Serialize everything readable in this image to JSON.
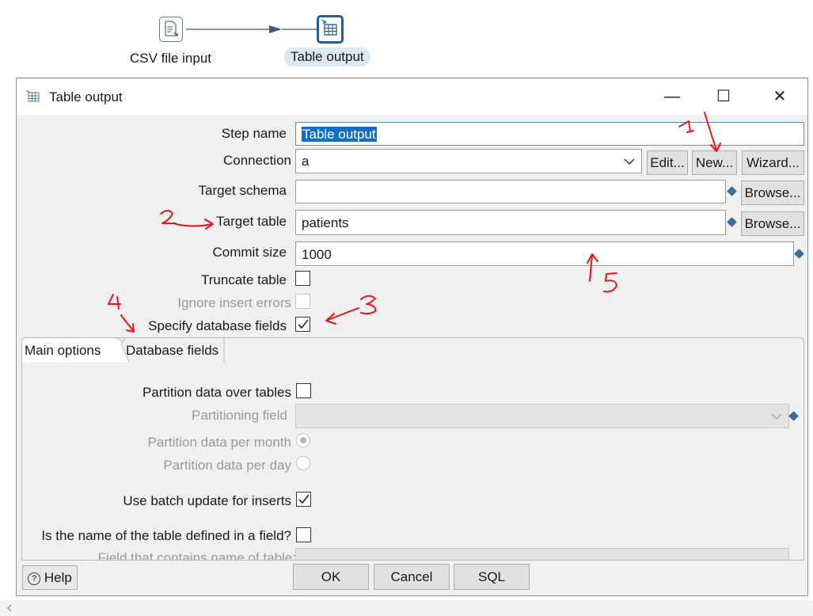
{
  "canvas": {
    "steps": [
      {
        "label": "CSV file input",
        "icon": "csv-file-icon"
      },
      {
        "label": "Table output",
        "icon": "table-output-icon"
      }
    ]
  },
  "dialog": {
    "title": "Table output",
    "controls": {
      "minimize": "—",
      "maximize": "☐",
      "close": "✕"
    },
    "step_name": {
      "label": "Step name",
      "value": "Table output"
    },
    "connection": {
      "label": "Connection",
      "value": "a",
      "edit": "Edit...",
      "new": "New...",
      "wizard": "Wizard..."
    },
    "target_schema": {
      "label": "Target schema",
      "value": "",
      "browse": "Browse..."
    },
    "target_table": {
      "label": "Target table",
      "value": "patients",
      "browse": "Browse..."
    },
    "commit_size": {
      "label": "Commit size",
      "value": "1000"
    },
    "truncate_table": {
      "label": "Truncate table",
      "checked": false
    },
    "ignore_insert_errors": {
      "label": "Ignore insert errors",
      "checked": false,
      "disabled": true
    },
    "specify_db_fields": {
      "label": "Specify database fields",
      "checked": true
    },
    "tabs": [
      "Main options",
      "Database fields"
    ],
    "main_options": {
      "partition_over_tables": {
        "label": "Partition data over tables",
        "checked": false
      },
      "partitioning_field": {
        "label": "Partitioning field",
        "value": ""
      },
      "partition_per_month": {
        "label": "Partition data per month"
      },
      "partition_per_day": {
        "label": "Partition data per day"
      },
      "batch_update": {
        "label": "Use batch update for inserts",
        "checked": true
      },
      "table_name_in_field": {
        "label": "Is the name of the table defined in a field?",
        "checked": false
      },
      "field_containing_table": {
        "label": "Field that contains name of table:"
      }
    },
    "buttons": {
      "help": "Help",
      "ok": "OK",
      "cancel": "Cancel",
      "sql": "SQL"
    }
  },
  "colors": {
    "accent": "#1d5f99",
    "annotation": "#e8141b",
    "selection": "#0f6fc6"
  }
}
